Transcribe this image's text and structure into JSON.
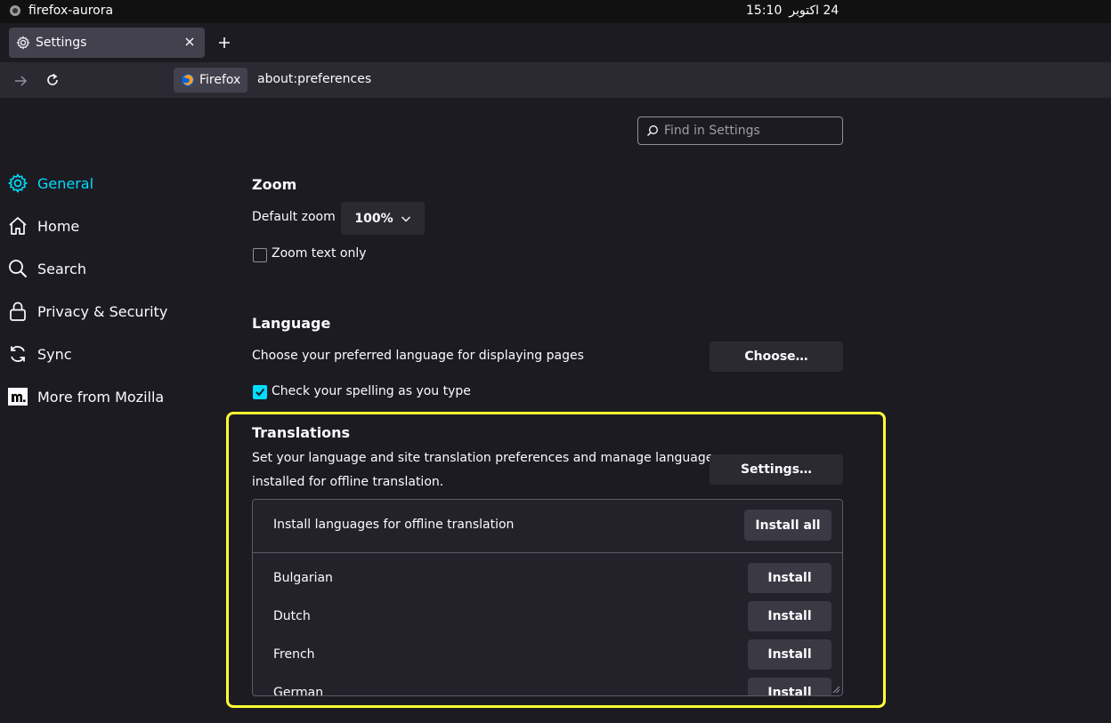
{
  "system_bar": {
    "app_name": "firefox-aurora",
    "clock_time": "15:10",
    "clock_date": "24 اكتوبر"
  },
  "tab": {
    "title": "Settings"
  },
  "navbar": {
    "identity_label": "Firefox",
    "url": "about:preferences"
  },
  "search": {
    "placeholder": "Find in Settings"
  },
  "sidebar": {
    "items": [
      {
        "label": "General",
        "icon": "gear-icon",
        "active": true
      },
      {
        "label": "Home",
        "icon": "home-icon"
      },
      {
        "label": "Search",
        "icon": "search-icon"
      },
      {
        "label": "Privacy & Security",
        "icon": "lock-icon"
      },
      {
        "label": "Sync",
        "icon": "sync-icon"
      },
      {
        "label": "More from Mozilla",
        "icon": "mozilla-icon"
      }
    ]
  },
  "zoom": {
    "heading": "Zoom",
    "default_label": "Default zoom",
    "default_value": "100%",
    "text_only_label": "Zoom text only",
    "text_only_checked": false
  },
  "language": {
    "heading": "Language",
    "description": "Choose your preferred language for displaying pages",
    "choose_button": "Choose…",
    "spelling_label": "Check your spelling as you type",
    "spelling_checked": true
  },
  "translations": {
    "heading": "Translations",
    "description_line1": "Set your language and site translation preferences and manage languages",
    "description_line2": "installed for offline translation.",
    "settings_button": "Settings…",
    "install_header": "Install languages for offline translation",
    "install_all_button": "Install all",
    "languages": [
      {
        "name": "Bulgarian",
        "button": "Install"
      },
      {
        "name": "Dutch",
        "button": "Install"
      },
      {
        "name": "French",
        "button": "Install"
      },
      {
        "name": "German",
        "button": "Install"
      }
    ]
  },
  "colors": {
    "accent": "#00ddff",
    "highlight": "#ffff33",
    "background": "#1c1b22"
  }
}
